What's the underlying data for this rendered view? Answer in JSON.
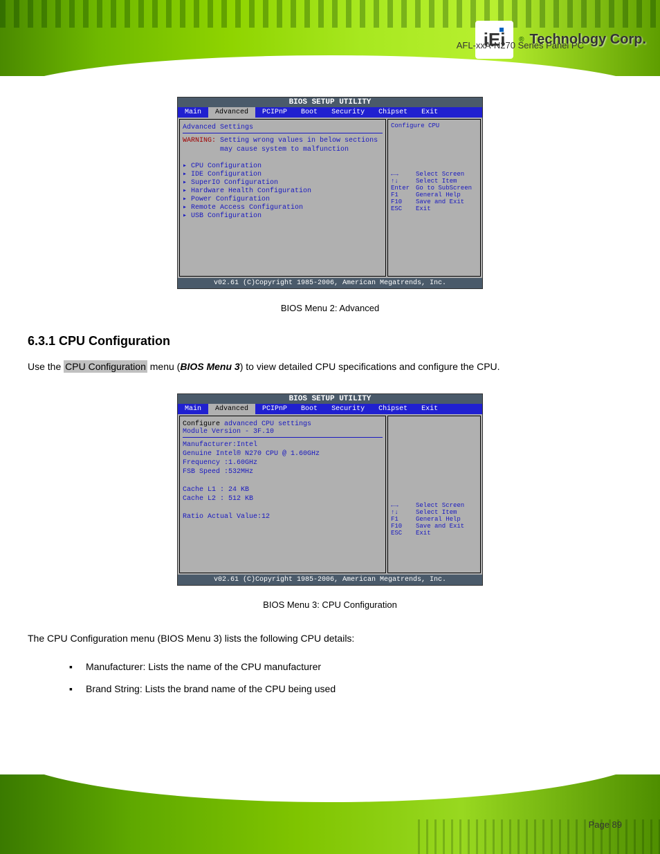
{
  "header": {
    "logo_text": "iEi",
    "company": "Technology Corp.",
    "product": "AFL-xxA-N270 Series Panel PC"
  },
  "bios1": {
    "utility_title": "BIOS SETUP UTILITY",
    "tabs": [
      "Main",
      "Advanced",
      "PCIPnP",
      "Boot",
      "Security",
      "Chipset",
      "Exit"
    ],
    "heading": "Advanced Settings",
    "warning_label": "WARNING:",
    "warning_line1": "Setting wrong values in below sections",
    "warning_line2": "may cause system to malfunction",
    "menu_items": [
      "CPU Configuration",
      "IDE Configuration",
      "SuperIO Configuration",
      "Hardware Health Configuration",
      "Power Configuration",
      "Remote Access Configuration",
      "USB Configuration"
    ],
    "right_title": "Configure CPU",
    "help": [
      {
        "key": "←→",
        "label": "Select Screen"
      },
      {
        "key": "↑↓",
        "label": "Select Item"
      },
      {
        "key": "Enter",
        "label": "Go to SubScreen"
      },
      {
        "key": "F1",
        "label": "General Help"
      },
      {
        "key": "F10",
        "label": "Save and Exit"
      },
      {
        "key": "ESC",
        "label": "Exit"
      }
    ],
    "footer": "v02.61 (C)Copyright 1985-2006, American Megatrends, Inc."
  },
  "caption1": "BIOS Menu 2: Advanced",
  "section1": {
    "heading": "6.3.1 CPU Configuration",
    "para_pre": "Use the ",
    "para_hl": "CPU Configuration",
    "para_mid": " menu (",
    "para_ref": "BIOS Menu 3",
    "para_post": ") to view detailed CPU specifications and configure the CPU."
  },
  "bios2": {
    "utility_title": "BIOS SETUP UTILITY",
    "tabs": [
      "Main",
      "Advanced",
      "PCIPnP",
      "Boot",
      "Security",
      "Chipset",
      "Exit"
    ],
    "line1_a": "Configure",
    "line1_b": " advanced CPU settings",
    "line2": "Module Version - 3F.10",
    "line3": "Manufacturer:Intel",
    "line4": "Genuine Intel® N270 CPU  @ 1.60GHz",
    "line5": "Frequency   :1.60GHz",
    "line6": "FSB Speed   :532MHz",
    "line7": "Cache L1    : 24 KB",
    "line8": "Cache L2    : 512 KB",
    "line9": "Ratio Actual Value:12",
    "help": [
      {
        "key": "←→",
        "label": "Select Screen"
      },
      {
        "key": "↑↓",
        "label": "Select Item"
      },
      {
        "key": "F1",
        "label": "General Help"
      },
      {
        "key": "F10",
        "label": "Save and Exit"
      },
      {
        "key": "ESC",
        "label": "Exit"
      }
    ],
    "footer": "v02.61 (C)Copyright 1985-2006, American Megatrends, Inc."
  },
  "caption2": "BIOS Menu 3: CPU Configuration",
  "section2": {
    "para": "The CPU Configuration menu (BIOS Menu 3) lists the following CPU details:",
    "bullets": [
      "Manufacturer: Lists the name of the CPU manufacturer",
      "Brand String: Lists the brand name of the CPU being used"
    ]
  },
  "footer": {
    "page": "Page 89"
  }
}
